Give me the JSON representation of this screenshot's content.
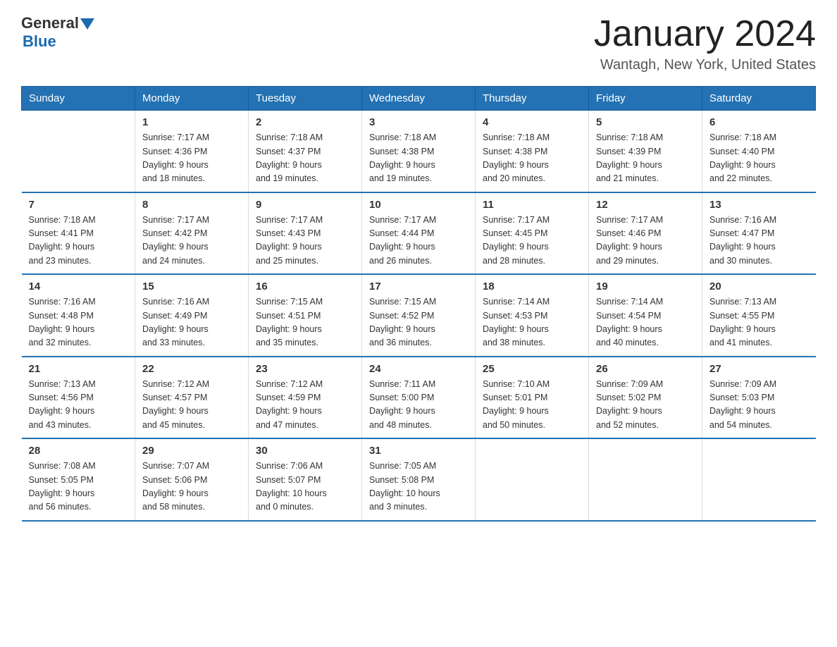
{
  "header": {
    "logo_general": "General",
    "logo_blue": "Blue",
    "month_title": "January 2024",
    "location": "Wantagh, New York, United States"
  },
  "weekdays": [
    "Sunday",
    "Monday",
    "Tuesday",
    "Wednesday",
    "Thursday",
    "Friday",
    "Saturday"
  ],
  "weeks": [
    [
      {
        "day": "",
        "info": ""
      },
      {
        "day": "1",
        "info": "Sunrise: 7:17 AM\nSunset: 4:36 PM\nDaylight: 9 hours\nand 18 minutes."
      },
      {
        "day": "2",
        "info": "Sunrise: 7:18 AM\nSunset: 4:37 PM\nDaylight: 9 hours\nand 19 minutes."
      },
      {
        "day": "3",
        "info": "Sunrise: 7:18 AM\nSunset: 4:38 PM\nDaylight: 9 hours\nand 19 minutes."
      },
      {
        "day": "4",
        "info": "Sunrise: 7:18 AM\nSunset: 4:38 PM\nDaylight: 9 hours\nand 20 minutes."
      },
      {
        "day": "5",
        "info": "Sunrise: 7:18 AM\nSunset: 4:39 PM\nDaylight: 9 hours\nand 21 minutes."
      },
      {
        "day": "6",
        "info": "Sunrise: 7:18 AM\nSunset: 4:40 PM\nDaylight: 9 hours\nand 22 minutes."
      }
    ],
    [
      {
        "day": "7",
        "info": "Sunrise: 7:18 AM\nSunset: 4:41 PM\nDaylight: 9 hours\nand 23 minutes."
      },
      {
        "day": "8",
        "info": "Sunrise: 7:17 AM\nSunset: 4:42 PM\nDaylight: 9 hours\nand 24 minutes."
      },
      {
        "day": "9",
        "info": "Sunrise: 7:17 AM\nSunset: 4:43 PM\nDaylight: 9 hours\nand 25 minutes."
      },
      {
        "day": "10",
        "info": "Sunrise: 7:17 AM\nSunset: 4:44 PM\nDaylight: 9 hours\nand 26 minutes."
      },
      {
        "day": "11",
        "info": "Sunrise: 7:17 AM\nSunset: 4:45 PM\nDaylight: 9 hours\nand 28 minutes."
      },
      {
        "day": "12",
        "info": "Sunrise: 7:17 AM\nSunset: 4:46 PM\nDaylight: 9 hours\nand 29 minutes."
      },
      {
        "day": "13",
        "info": "Sunrise: 7:16 AM\nSunset: 4:47 PM\nDaylight: 9 hours\nand 30 minutes."
      }
    ],
    [
      {
        "day": "14",
        "info": "Sunrise: 7:16 AM\nSunset: 4:48 PM\nDaylight: 9 hours\nand 32 minutes."
      },
      {
        "day": "15",
        "info": "Sunrise: 7:16 AM\nSunset: 4:49 PM\nDaylight: 9 hours\nand 33 minutes."
      },
      {
        "day": "16",
        "info": "Sunrise: 7:15 AM\nSunset: 4:51 PM\nDaylight: 9 hours\nand 35 minutes."
      },
      {
        "day": "17",
        "info": "Sunrise: 7:15 AM\nSunset: 4:52 PM\nDaylight: 9 hours\nand 36 minutes."
      },
      {
        "day": "18",
        "info": "Sunrise: 7:14 AM\nSunset: 4:53 PM\nDaylight: 9 hours\nand 38 minutes."
      },
      {
        "day": "19",
        "info": "Sunrise: 7:14 AM\nSunset: 4:54 PM\nDaylight: 9 hours\nand 40 minutes."
      },
      {
        "day": "20",
        "info": "Sunrise: 7:13 AM\nSunset: 4:55 PM\nDaylight: 9 hours\nand 41 minutes."
      }
    ],
    [
      {
        "day": "21",
        "info": "Sunrise: 7:13 AM\nSunset: 4:56 PM\nDaylight: 9 hours\nand 43 minutes."
      },
      {
        "day": "22",
        "info": "Sunrise: 7:12 AM\nSunset: 4:57 PM\nDaylight: 9 hours\nand 45 minutes."
      },
      {
        "day": "23",
        "info": "Sunrise: 7:12 AM\nSunset: 4:59 PM\nDaylight: 9 hours\nand 47 minutes."
      },
      {
        "day": "24",
        "info": "Sunrise: 7:11 AM\nSunset: 5:00 PM\nDaylight: 9 hours\nand 48 minutes."
      },
      {
        "day": "25",
        "info": "Sunrise: 7:10 AM\nSunset: 5:01 PM\nDaylight: 9 hours\nand 50 minutes."
      },
      {
        "day": "26",
        "info": "Sunrise: 7:09 AM\nSunset: 5:02 PM\nDaylight: 9 hours\nand 52 minutes."
      },
      {
        "day": "27",
        "info": "Sunrise: 7:09 AM\nSunset: 5:03 PM\nDaylight: 9 hours\nand 54 minutes."
      }
    ],
    [
      {
        "day": "28",
        "info": "Sunrise: 7:08 AM\nSunset: 5:05 PM\nDaylight: 9 hours\nand 56 minutes."
      },
      {
        "day": "29",
        "info": "Sunrise: 7:07 AM\nSunset: 5:06 PM\nDaylight: 9 hours\nand 58 minutes."
      },
      {
        "day": "30",
        "info": "Sunrise: 7:06 AM\nSunset: 5:07 PM\nDaylight: 10 hours\nand 0 minutes."
      },
      {
        "day": "31",
        "info": "Sunrise: 7:05 AM\nSunset: 5:08 PM\nDaylight: 10 hours\nand 3 minutes."
      },
      {
        "day": "",
        "info": ""
      },
      {
        "day": "",
        "info": ""
      },
      {
        "day": "",
        "info": ""
      }
    ]
  ]
}
